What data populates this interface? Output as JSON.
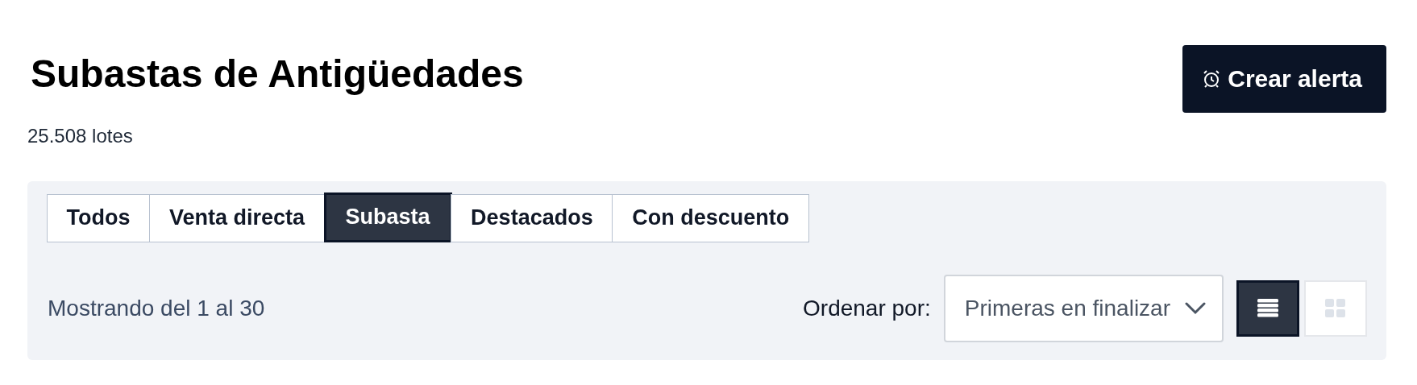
{
  "header": {
    "title": "Subastas de Antigüedades",
    "count": "25.508 lotes",
    "alert_button": "Crear alerta"
  },
  "tabs": [
    {
      "label": "Todos",
      "selected": false
    },
    {
      "label": "Venta directa",
      "selected": false
    },
    {
      "label": "Subasta",
      "selected": true
    },
    {
      "label": "Destacados",
      "selected": false
    },
    {
      "label": "Con descuento",
      "selected": false
    }
  ],
  "results": "Mostrando del 1 al 30",
  "sort": {
    "label": "Ordenar por:",
    "value": "Primeras en finalizar"
  },
  "views": [
    {
      "kind": "list",
      "selected": true
    },
    {
      "kind": "grid",
      "selected": false
    }
  ]
}
